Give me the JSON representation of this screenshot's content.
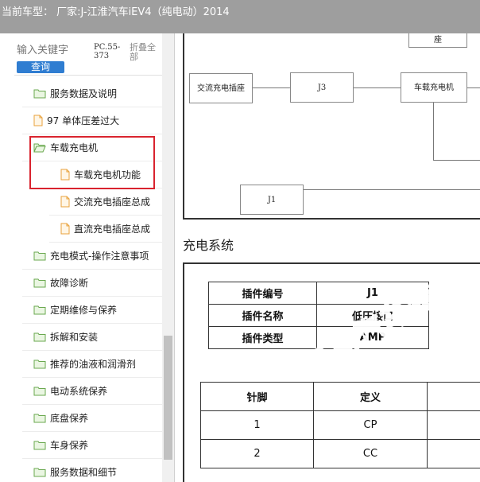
{
  "titlebar": {
    "text": "当前车型： 厂家:J-江淮汽车iEV4（纯电动）2014"
  },
  "search": {
    "placeholder": "输入关键字",
    "button_label": "查询",
    "pc_code": "PC.55-373",
    "collapse_all": "折叠全部"
  },
  "tree": {
    "items": [
      {
        "type": "folder",
        "label": "服务数据及说明"
      },
      {
        "type": "file",
        "label": "97 单体压差过大"
      },
      {
        "type": "folder-open",
        "label": "车载充电机"
      },
      {
        "type": "file",
        "label": "车载充电机功能"
      },
      {
        "type": "file",
        "label": "交流充电插座总成"
      },
      {
        "type": "file",
        "label": "直流充电插座总成"
      },
      {
        "type": "folder",
        "label": "充电模式-操作注意事项"
      },
      {
        "type": "folder",
        "label": "故障诊断"
      },
      {
        "type": "folder",
        "label": "定期维修与保养"
      },
      {
        "type": "folder",
        "label": "拆解和安装"
      },
      {
        "type": "folder",
        "label": "推荐的油液和润滑剂"
      },
      {
        "type": "folder",
        "label": "电动系统保养"
      },
      {
        "type": "folder",
        "label": "底盘保养"
      },
      {
        "type": "folder",
        "label": "车身保养"
      },
      {
        "type": "folder",
        "label": "服务数据和细节"
      }
    ]
  },
  "diagram": {
    "top_box": "座",
    "ac_socket": "交流充电插座",
    "j3": "J3",
    "charger": "车载充电机",
    "j1": "J1"
  },
  "section": {
    "title": "充电系统"
  },
  "connector_table": {
    "rows": [
      {
        "key": "插件编号",
        "value": "J1"
      },
      {
        "key": "插件名称",
        "value": "低压接口"
      },
      {
        "key": "插件类型",
        "value": "AMP"
      }
    ]
  },
  "pin_table": {
    "headers": [
      "针脚",
      "定义"
    ],
    "rows": [
      [
        "1",
        "CP"
      ],
      [
        "2",
        "CC"
      ]
    ]
  },
  "watermark": "畅易汽车维修",
  "colors": {
    "highlight": "#d9232e",
    "button": "#2f7dd1",
    "folder": "#6aa84f",
    "file": "#e8a23c",
    "watermark": "#2f86d6"
  }
}
